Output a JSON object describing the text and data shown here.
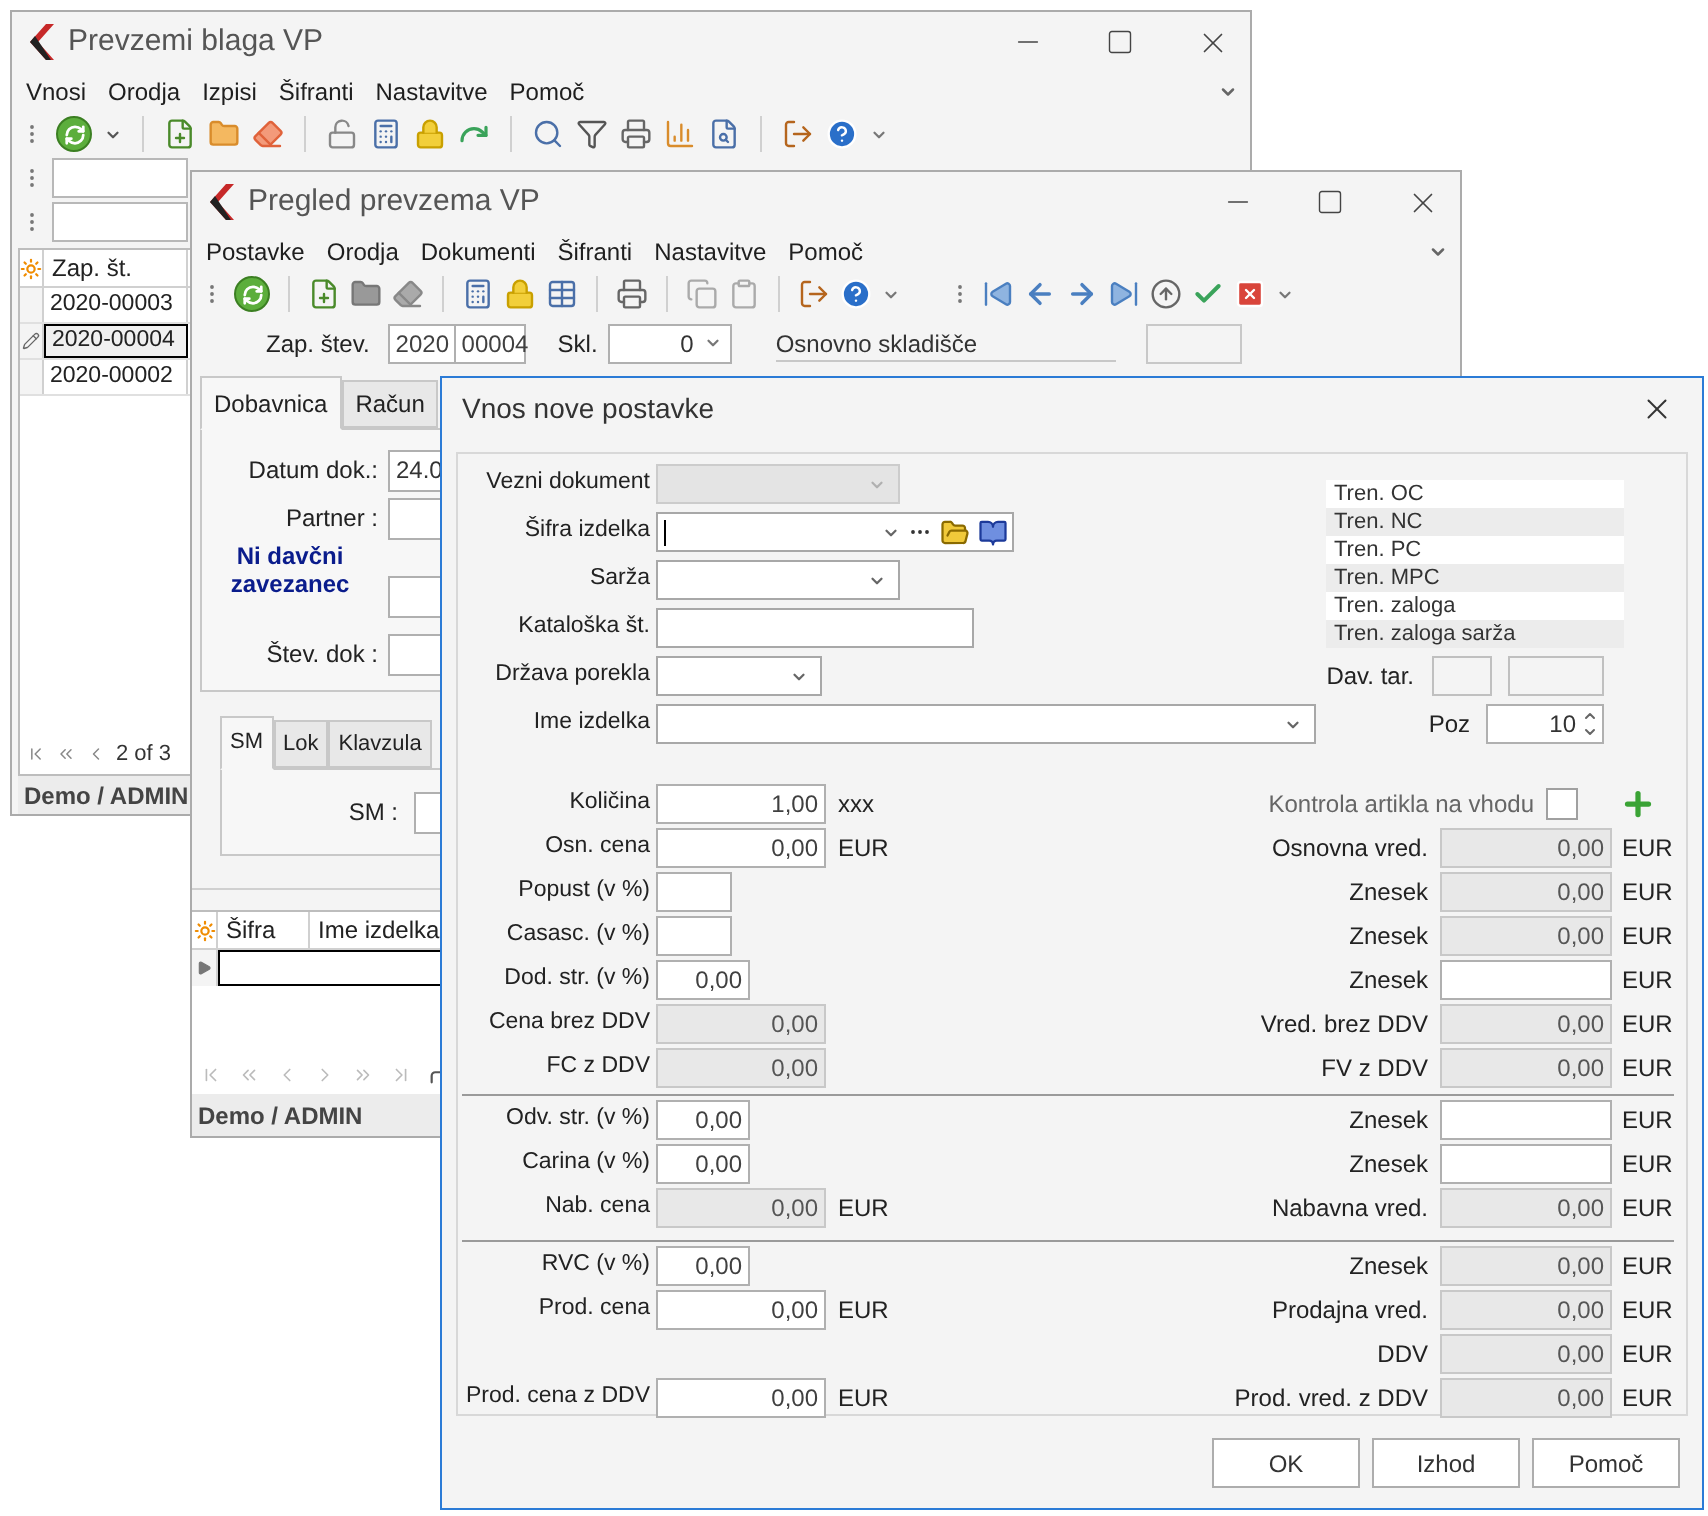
{
  "window_back": {
    "title": "Prevzemi blaga VP",
    "menu": [
      "Vnosi",
      "Orodja",
      "Izpisi",
      "Šifranti",
      "Nastavitve",
      "Pomoč"
    ],
    "table": {
      "columns": [
        "Zap. št."
      ],
      "rows": [
        {
          "cells": [
            "2020-00003"
          ],
          "selected": false
        },
        {
          "cells": [
            "2020-00004"
          ],
          "selected": true
        },
        {
          "cells": [
            "2020-00002"
          ],
          "selected": false
        }
      ]
    },
    "pager": "2 of 3",
    "status_bar": "Demo / ADMIN"
  },
  "window_middle": {
    "title": "Pregled prevzema VP",
    "menu": [
      "Postavke",
      "Orodja",
      "Dokumenti",
      "Šifranti",
      "Nastavitve",
      "Pomoč"
    ],
    "header": {
      "number_label": "Zap. štev.",
      "year": "2020",
      "number": "00004",
      "warehouse_label": "Skl.",
      "warehouse": "0",
      "warehouse_name": "Osnovno skladišče"
    },
    "tabs": [
      {
        "label": "Dobavnica",
        "selected": true
      },
      {
        "label": "Račun",
        "selected": false
      }
    ],
    "fields": [
      {
        "kind": "normal",
        "label": "Datum dok.:",
        "value": "24.0"
      },
      {
        "kind": "normal",
        "label": "Partner :"
      },
      {
        "kind": "warning",
        "label": "Ni davčni zavezanec"
      },
      {
        "kind": "normal",
        "label": "Štev. dok :"
      }
    ],
    "sub_tabs": [
      {
        "label": "SM",
        "selected": true
      },
      {
        "label": "Lok",
        "selected": false
      },
      {
        "label": "Klavzula",
        "selected": false
      }
    ],
    "sm_label": "SM :",
    "items_table": {
      "columns": [
        "Šifra",
        "Ime izdelka"
      ]
    },
    "status_bar": "Demo / ADMIN"
  },
  "dialog": {
    "title": "Vnos nove postavke",
    "top_fields": [
      {
        "kind": "combo",
        "label": "Vezni dokument",
        "disabled": true
      },
      {
        "kind": "lookup",
        "label": "Šifra izdelka",
        "disabled": false
      },
      {
        "kind": "combo",
        "label": "Sarža",
        "disabled": false
      },
      {
        "kind": "text",
        "label": "Kataloška št.",
        "disabled": false
      },
      {
        "kind": "combo",
        "label": "Država porekla",
        "disabled": false
      },
      {
        "kind": "combo",
        "label": "Ime izdelka",
        "disabled": false
      }
    ],
    "info_list": [
      "Tren. OC",
      "Tren. NC",
      "Tren. PC",
      "Tren. MPC",
      "Tren. zaloga",
      "Tren. zaloga sarža"
    ],
    "tax": {
      "label": "Dav. tar."
    },
    "position": {
      "label": "Poz",
      "value": "10"
    },
    "sections": [
      [
        {
          "left": {
            "kind": "wide",
            "label": "Količina",
            "value": "1,00",
            "unit": "xxx",
            "disabled": false
          },
          "right": {
            "kind": "checkbox",
            "label": "Kontrola artikla na vhodu",
            "checked": false
          }
        },
        {
          "left": {
            "kind": "wide",
            "label": "Osn. cena",
            "value": "0,00",
            "unit": "EUR",
            "disabled": false
          },
          "right": {
            "kind": "amount",
            "label": "Osnovna vred.",
            "value": "0,00",
            "unit": "EUR",
            "disabled": true
          }
        },
        {
          "left": {
            "kind": "small",
            "label": "Popust (v %)",
            "disabled": false
          },
          "right": {
            "kind": "amount",
            "label": "Znesek",
            "value": "0,00",
            "unit": "EUR",
            "disabled": true
          }
        },
        {
          "left": {
            "kind": "small",
            "label": "Casasc. (v %)",
            "disabled": false
          },
          "right": {
            "kind": "amount",
            "label": "Znesek",
            "value": "0,00",
            "unit": "EUR",
            "disabled": true
          }
        },
        {
          "left": {
            "kind": "short",
            "label": "Dod. str. (v %)",
            "value": "0,00",
            "disabled": false
          },
          "right": {
            "kind": "amount",
            "label": "Znesek",
            "unit": "EUR",
            "disabled": false
          }
        },
        {
          "left": {
            "kind": "wide",
            "label": "Cena brez DDV",
            "value": "0,00",
            "disabled": true
          },
          "right": {
            "kind": "amount",
            "label": "Vred. brez DDV",
            "value": "0,00",
            "unit": "EUR",
            "disabled": true
          }
        },
        {
          "left": {
            "kind": "wide",
            "label": "FC z DDV",
            "value": "0,00",
            "disabled": true
          },
          "right": {
            "kind": "amount",
            "label": "FV z DDV",
            "value": "0,00",
            "unit": "EUR",
            "disabled": true
          }
        }
      ],
      [
        {
          "left": {
            "kind": "short",
            "label": "Odv. str. (v %)",
            "value": "0,00",
            "disabled": false
          },
          "right": {
            "kind": "amount",
            "label": "Znesek",
            "unit": "EUR",
            "disabled": false
          }
        },
        {
          "left": {
            "kind": "short",
            "label": "Carina (v %)",
            "value": "0,00",
            "disabled": false
          },
          "right": {
            "kind": "amount",
            "label": "Znesek",
            "unit": "EUR",
            "disabled": false
          }
        },
        {
          "left": {
            "kind": "wide",
            "label": "Nab. cena",
            "value": "0,00",
            "unit": "EUR",
            "disabled": true
          },
          "right": {
            "kind": "amount",
            "label": "Nabavna vred.",
            "value": "0,00",
            "unit": "EUR",
            "disabled": true
          }
        }
      ],
      [
        {
          "left": {
            "kind": "short",
            "label": "RVC (v %)",
            "value": "0,00",
            "disabled": false
          },
          "right": {
            "kind": "amount",
            "label": "Znesek",
            "value": "0,00",
            "unit": "EUR",
            "disabled": true
          }
        },
        {
          "left": {
            "kind": "wide",
            "label": "Prod. cena",
            "value": "0,00",
            "unit": "EUR",
            "disabled": false
          },
          "right": {
            "kind": "amount",
            "label": "Prodajna vred.",
            "value": "0,00",
            "unit": "EUR",
            "disabled": true
          }
        },
        {
          "right": {
            "kind": "amount",
            "label": "DDV",
            "value": "0,00",
            "unit": "EUR",
            "disabled": true
          }
        },
        {
          "left": {
            "kind": "wide",
            "label": "Prod. cena z DDV",
            "value": "0,00",
            "unit": "EUR",
            "disabled": false
          },
          "right": {
            "kind": "amount",
            "label": "Prod. vred. z DDV",
            "value": "0,00",
            "unit": "EUR",
            "disabled": true
          }
        }
      ]
    ],
    "buttons": [
      "OK",
      "Izhod",
      "Pomoč"
    ]
  }
}
